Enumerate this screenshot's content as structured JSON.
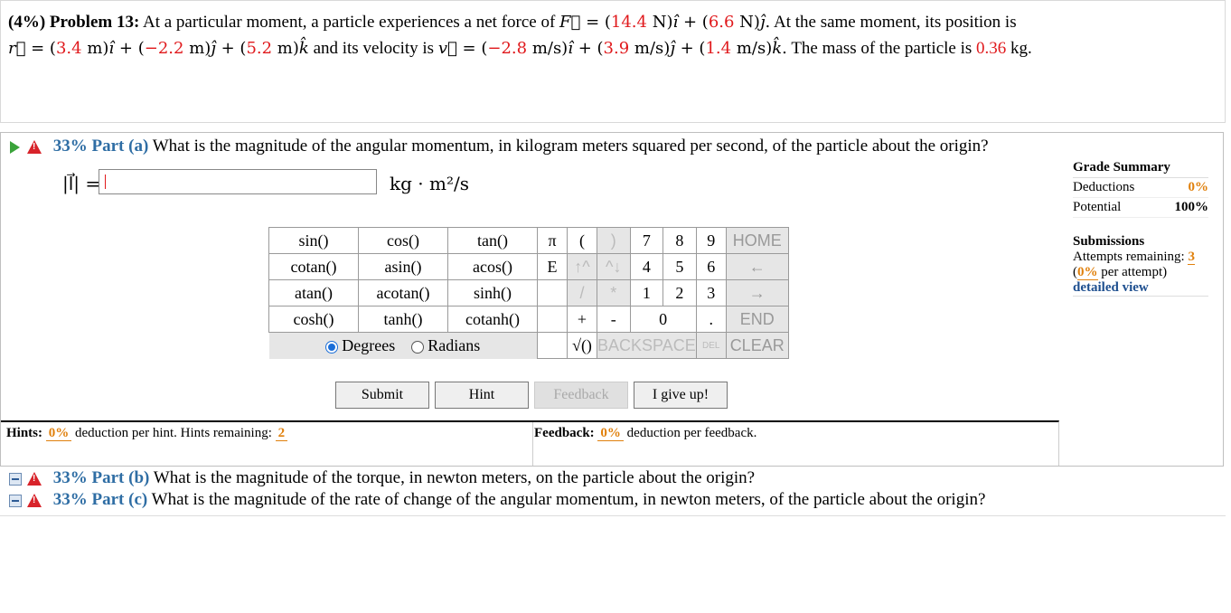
{
  "problem": {
    "weight": "(4%)",
    "title": "Problem 13:",
    "intro": "At a particular moment, a particle experiences a net force of",
    "force_x": "14.4",
    "force_y": "6.6",
    "pos_text": "At the same moment, its position is",
    "pos_x": "3.4",
    "pos_y": "−2.2",
    "pos_z": "5.2",
    "vel_text": "and its velocity is",
    "vel_x": "−2.8",
    "vel_y": "3.9",
    "vel_z": "1.4",
    "mass_text": "The mass of the particle is",
    "mass": "0.36",
    "mass_unit": "kg."
  },
  "part_a": {
    "percent": "33%",
    "label": "Part (a)",
    "question": "What is the magnitude of the angular momentum, in kilogram meters squared per second, of the particle about the origin?",
    "units": "kg · m²/s",
    "lhs": "|l⃗| ="
  },
  "keypad": {
    "functions": [
      [
        "sin()",
        "cos()",
        "tan()"
      ],
      [
        "cotan()",
        "asin()",
        "acos()"
      ],
      [
        "atan()",
        "acotan()",
        "sinh()"
      ],
      [
        "cosh()",
        "tanh()",
        "cotanh()"
      ]
    ],
    "symbols": [
      "π",
      "(",
      ")",
      "E",
      "↑^",
      "^↓",
      "/",
      "*",
      "+",
      "-",
      "√()"
    ],
    "digits": [
      "7",
      "8",
      "9",
      "4",
      "5",
      "6",
      "1",
      "2",
      "3",
      "0",
      "."
    ],
    "nav": [
      "HOME",
      "←",
      "→",
      "END",
      "CLEAR"
    ],
    "backspace": "BACKSPACE",
    "del": "DEL",
    "degrees": "Degrees",
    "radians": "Radians"
  },
  "buttons": {
    "submit": "Submit",
    "hint": "Hint",
    "feedback": "Feedback",
    "give_up": "I give up!"
  },
  "grade": {
    "title": "Grade Summary",
    "deductions_label": "Deductions",
    "deductions": "0%",
    "potential_label": "Potential",
    "potential": "100%",
    "submissions": "Submissions",
    "attempts_label": "Attempts remaining:",
    "attempts": "3",
    "per_attempt_pct": "0%",
    "per_attempt": "per attempt)",
    "detailed": "detailed view"
  },
  "hints": {
    "label": "Hints:",
    "pct": "0%",
    "text": "deduction per hint. Hints remaining:",
    "remaining": "2"
  },
  "feedback": {
    "label": "Feedback:",
    "pct": "0%",
    "text": "deduction per feedback."
  },
  "part_b": {
    "percent": "33%",
    "label": "Part (b)",
    "question": "What is the magnitude of the torque, in newton meters, on the particle about the origin?"
  },
  "part_c": {
    "percent": "33%",
    "label": "Part (c)",
    "question": "What is the magnitude of the rate of change of the angular momentum, in newton meters, of the particle about the origin?"
  }
}
